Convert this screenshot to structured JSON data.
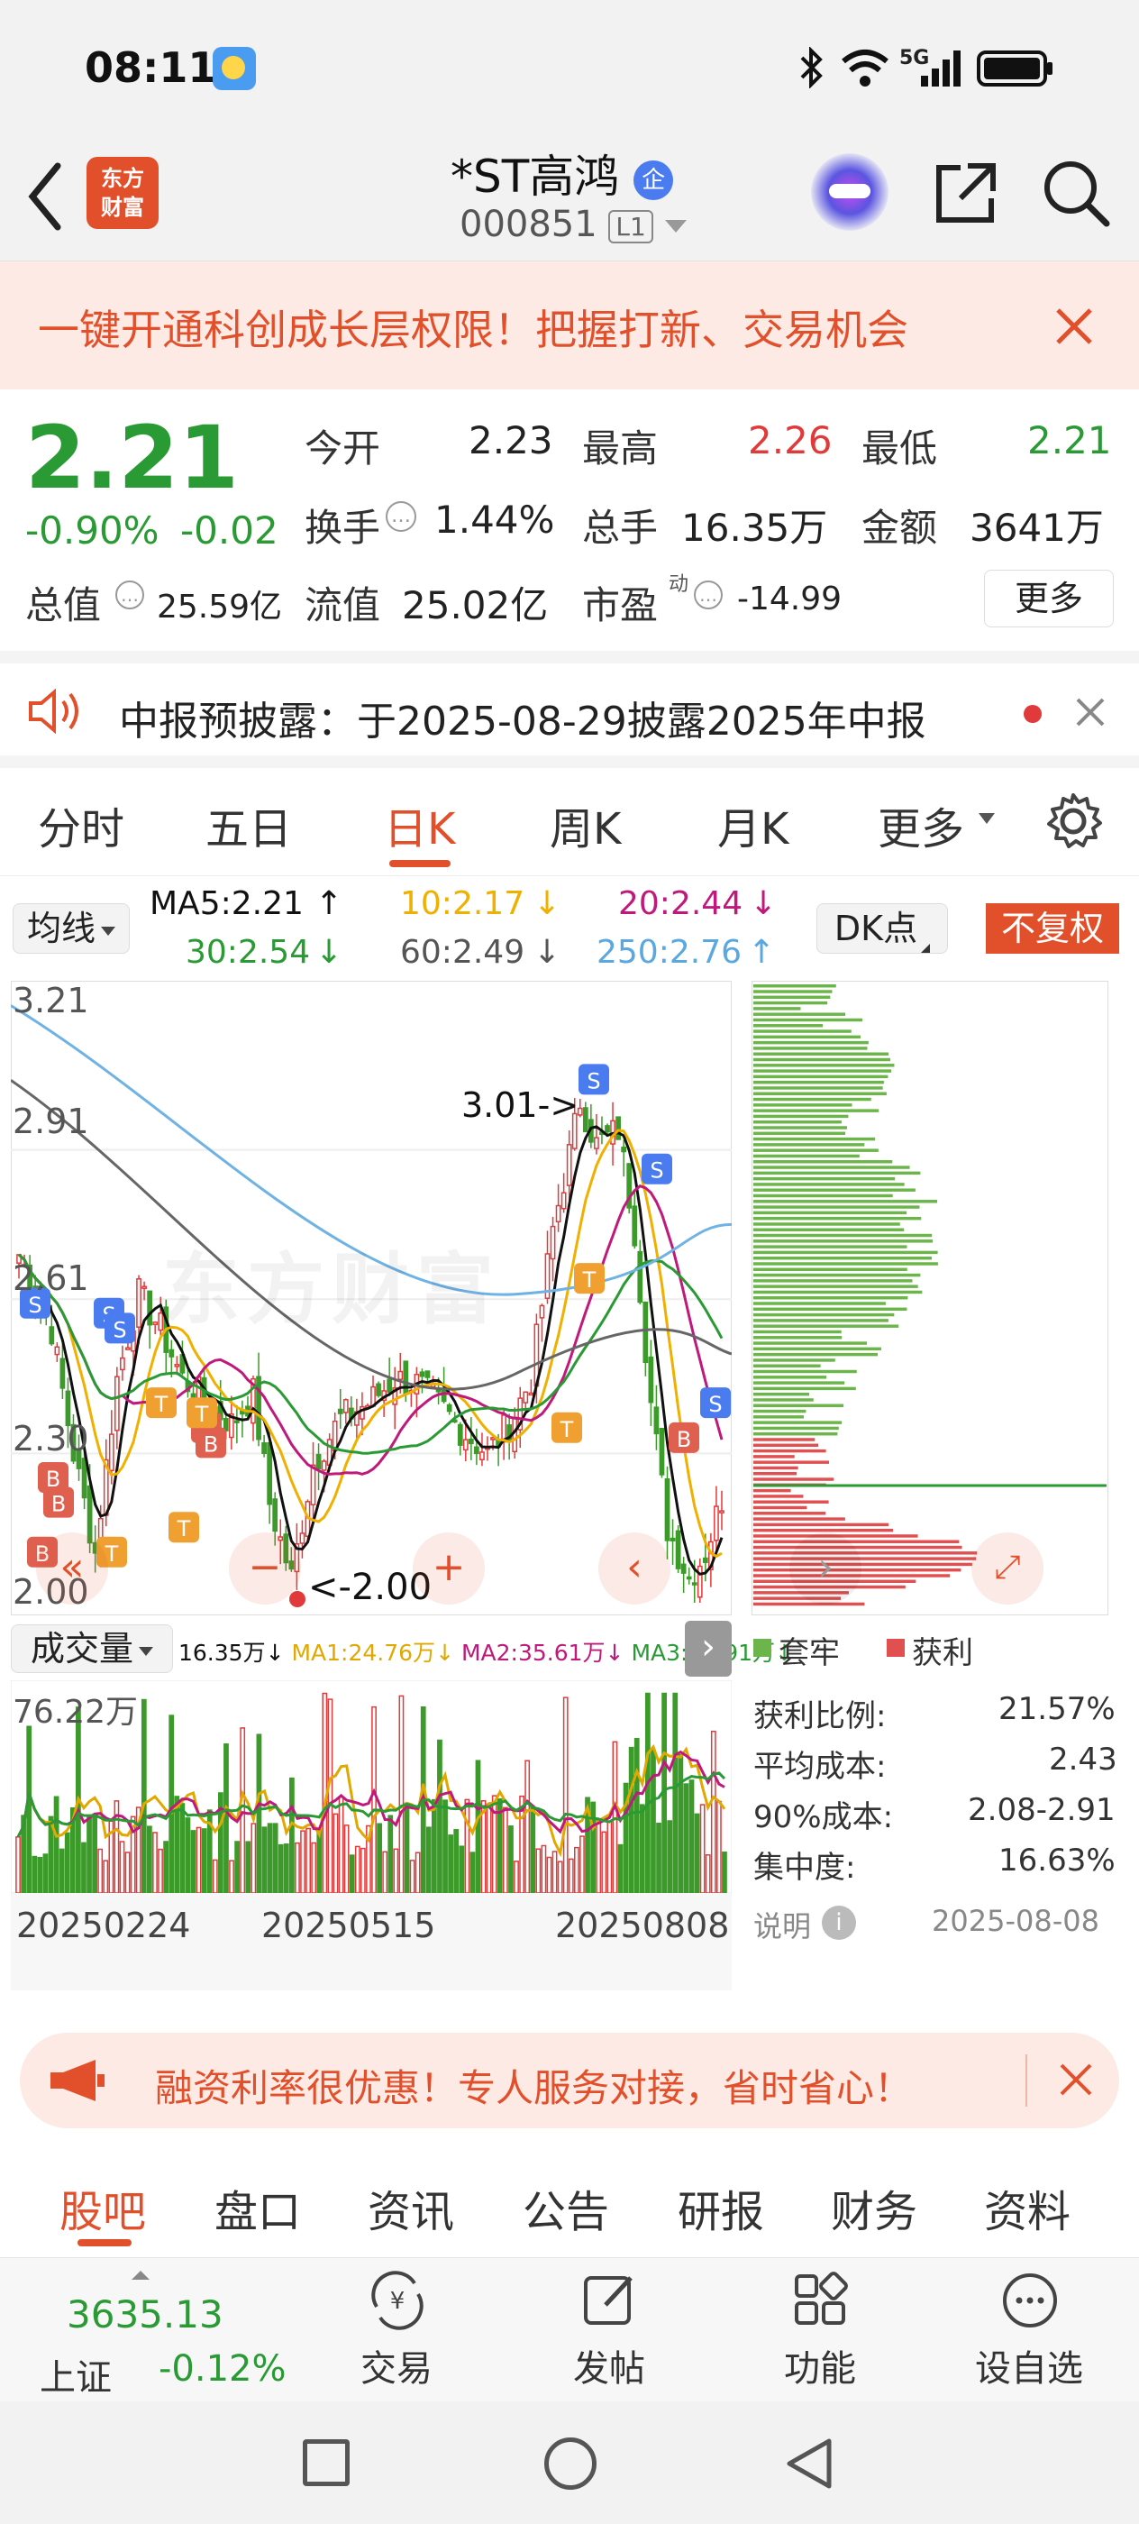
{
  "status_bar": {
    "time": "08:11",
    "network": "5G"
  },
  "header": {
    "brand_line1": "东方",
    "brand_line2": "财富",
    "stock_name": "*ST高鸿",
    "stock_badge": "企",
    "stock_code": "000851",
    "level": "L1"
  },
  "banner": {
    "text": "一键开通科创成长层权限！把握打新、交易机会"
  },
  "quote": {
    "price": "2.21",
    "change_pct": "-0.90%",
    "change": "-0.02",
    "open_label": "今开",
    "open": "2.23",
    "high_label": "最高",
    "high": "2.26",
    "low_label": "最低",
    "low": "2.21",
    "turnover_label": "换手",
    "turnover": "1.44%",
    "volume_label": "总手",
    "volume": "16.35万",
    "amount_label": "金额",
    "amount": "3641万",
    "mktcap_label": "总值",
    "mktcap": "25.59亿",
    "float_label": "流值",
    "float_cap": "25.02亿",
    "pe_label": "市盈",
    "pe_sup": "动",
    "pe": "-14.99",
    "more_button": "更多"
  },
  "notice": {
    "text": "中报预披露：于2025-08-29披露2025年中报"
  },
  "tabs": [
    "分时",
    "五日",
    "日K",
    "周K",
    "月K",
    "更多"
  ],
  "active_tab": 2,
  "kline": {
    "ma_selector": "均线",
    "ma5": "MA5:2.21",
    "ma10": "10:2.17",
    "ma20": "20:2.44",
    "ma30": "30:2.54",
    "ma60": "60:2.49",
    "ma250": "250:2.76",
    "dk_button": "DK点",
    "adjust_button": "不复权",
    "y_labels": [
      "3.21",
      "2.91",
      "2.61",
      "2.30",
      "2.00"
    ],
    "high_annotation": "3.01->",
    "low_annotation": "<-2.00",
    "watermark": "东方财富"
  },
  "volume": {
    "selector": "成交量",
    "vol": "16.35万",
    "ma1": "MA1:24.76万",
    "ma2": "MA2:35.61万",
    "ma3": "MA3:33.91万",
    "max_label": "76.22万",
    "dates": [
      "20250224",
      "20250515",
      "20250808"
    ]
  },
  "chips": {
    "legend_trapped": "套牢",
    "legend_profit": "获利",
    "profit_ratio_label": "获利比例:",
    "profit_ratio": "21.57%",
    "avg_cost_label": "平均成本:",
    "avg_cost": "2.43",
    "cost90_label": "90%成本:",
    "cost90": "2.08-2.91",
    "concentration_label": "集中度:",
    "concentration": "16.63%",
    "note_label": "说明",
    "date": "2025-08-08"
  },
  "promo": {
    "text": "融资利率很优惠！专人服务对接，省时省心！"
  },
  "subtabs": [
    "股吧",
    "盘口",
    "资讯",
    "公告",
    "研报",
    "财务",
    "资料"
  ],
  "bottom_bar": {
    "index_value": "3635.13",
    "index_name": "上证",
    "index_change": "-0.12%",
    "trade": "交易",
    "post": "发帖",
    "functions": "功能",
    "watch": "设自选"
  },
  "colors": {
    "accent": "#e2502b",
    "up": "#e03a3a",
    "down": "#2a9a35"
  }
}
